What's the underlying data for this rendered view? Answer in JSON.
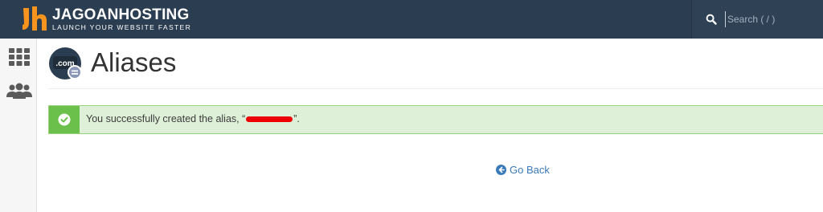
{
  "brand": {
    "name": "JAGOANHOSTING",
    "tagline": "LAUNCH YOUR WEBSITE FASTER",
    "accent": "#f7941d"
  },
  "search": {
    "placeholder": "Search ( / )",
    "icon": "search-icon"
  },
  "sidebar": {
    "items": [
      {
        "icon": "grid-icon",
        "label": ""
      },
      {
        "icon": "users-icon",
        "label": ""
      }
    ]
  },
  "page": {
    "title": "Aliases",
    "icon": "domain-alias-icon",
    "icon_text": ".com"
  },
  "alert": {
    "type": "success",
    "prefix": "You successfully created the alias, “",
    "suffix": "”.",
    "color": "#dff0d8",
    "icon_color": "#6bbf4b"
  },
  "actions": {
    "go_back": "Go Back"
  },
  "colors": {
    "topbar": "#2b3d51",
    "link": "#3a7ab8",
    "redaction": "#ee0000"
  }
}
